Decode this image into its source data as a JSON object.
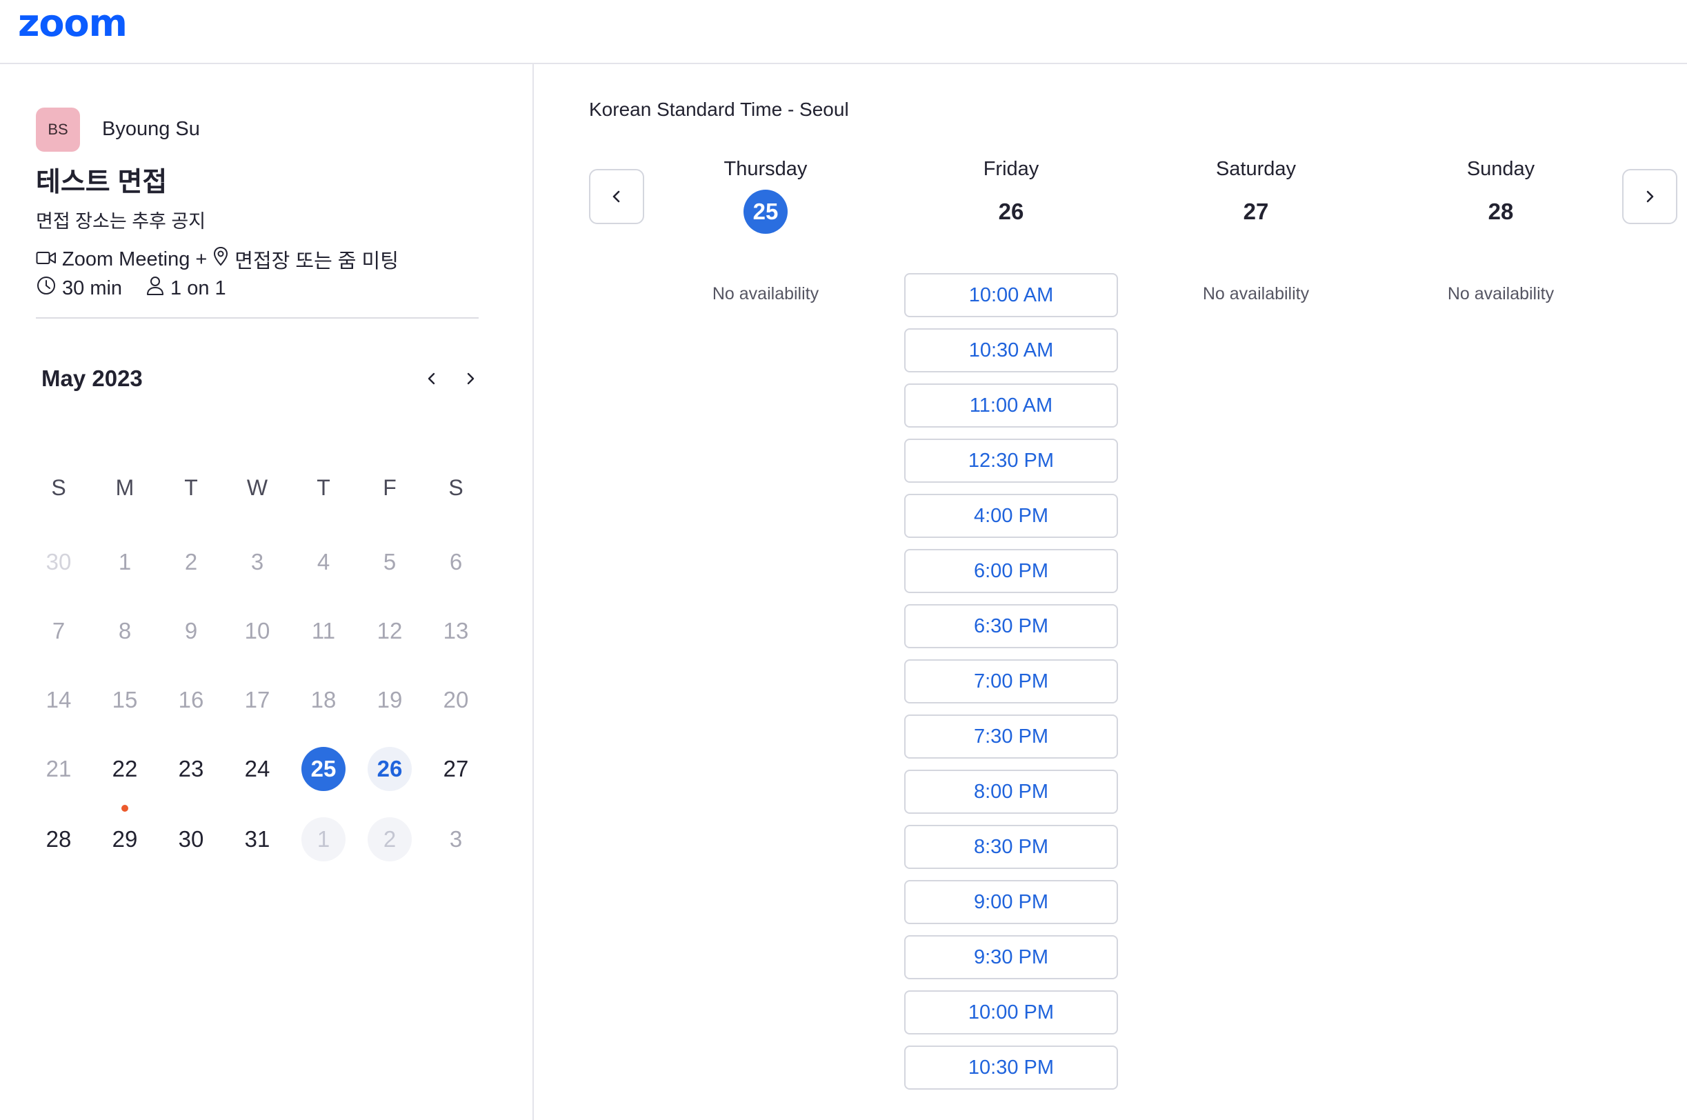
{
  "brand": {
    "logo_text": "zoom",
    "color": "#0b5cff"
  },
  "host": {
    "initials": "BS",
    "name": "Byoung Su",
    "avatar_color": "#f1b6c1"
  },
  "event": {
    "title": "테스트 면접",
    "description": "면접 장소는 추후 공지",
    "meeting_type": "Zoom Meeting",
    "plus": "+",
    "location": "면접장 또는 줌 미팅",
    "duration": "30 min",
    "format": "1 on 1",
    "icons": [
      "video-camera-icon",
      "location-pin-icon",
      "clock-icon",
      "person-icon"
    ]
  },
  "mini_calendar": {
    "month_label": "May 2023",
    "weekdays": [
      "S",
      "M",
      "T",
      "W",
      "T",
      "F",
      "S"
    ],
    "weeks": [
      [
        "30",
        "1",
        "2",
        "3",
        "4",
        "5",
        "6"
      ],
      [
        "7",
        "8",
        "9",
        "10",
        "11",
        "12",
        "13"
      ],
      [
        "14",
        "15",
        "16",
        "17",
        "18",
        "19",
        "20"
      ],
      [
        "21",
        "22",
        "23",
        "24",
        "25",
        "26",
        "27"
      ],
      [
        "28",
        "29",
        "30",
        "31",
        "1",
        "2",
        "3"
      ]
    ],
    "selected_day": "25",
    "today_marker_day": "22",
    "available_days": [
      "26"
    ],
    "selected_color": "#2a6ee0",
    "today_marker_color": "#ec5a2c"
  },
  "timezone": "Korean Standard Time - Seoul",
  "week_view": {
    "days": [
      {
        "name": "Thursday",
        "date": "25",
        "selected": true,
        "status": "No availability"
      },
      {
        "name": "Friday",
        "date": "26",
        "selected": false,
        "status": ""
      },
      {
        "name": "Saturday",
        "date": "27",
        "selected": false,
        "status": "No availability"
      },
      {
        "name": "Sunday",
        "date": "28",
        "selected": false,
        "status": "No availability"
      }
    ],
    "time_slots": [
      "10:00 AM",
      "10:30 AM",
      "11:00 AM",
      "12:30 PM",
      "4:00 PM",
      "6:00 PM",
      "6:30 PM",
      "7:00 PM",
      "7:30 PM",
      "8:00 PM",
      "8:30 PM",
      "9:00 PM",
      "9:30 PM",
      "10:00 PM",
      "10:30 PM"
    ],
    "slot_text_color": "#1f63dc"
  }
}
